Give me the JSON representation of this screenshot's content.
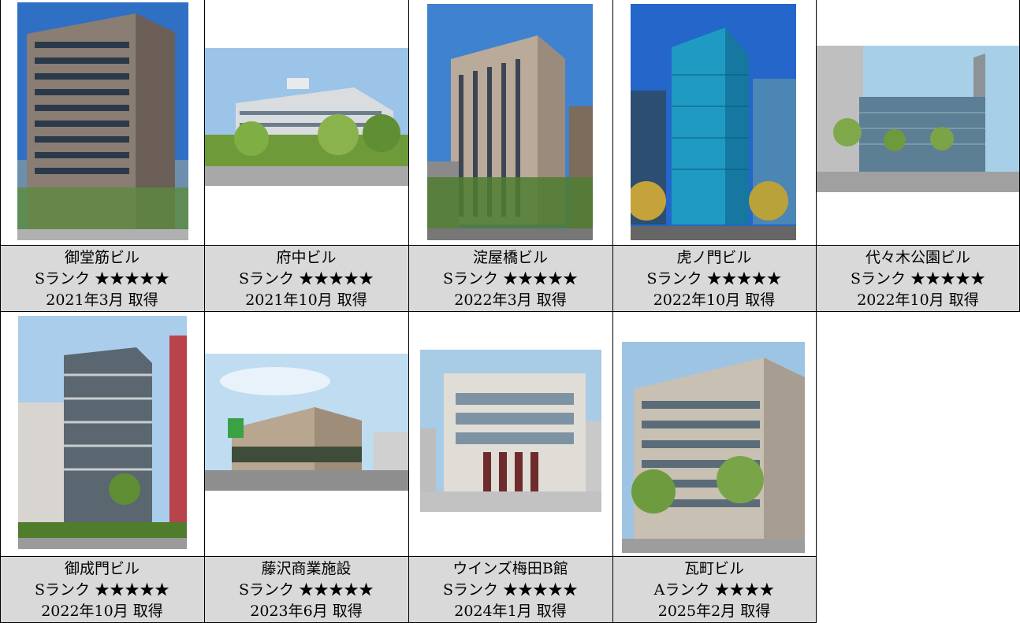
{
  "buildings": [
    {
      "name": "御堂筋ビル",
      "rank": "Sランク",
      "stars": "★★★★★",
      "acquired": "2021年3月 取得"
    },
    {
      "name": "府中ビル",
      "rank": "Sランク",
      "stars": "★★★★★",
      "acquired": "2021年10月 取得"
    },
    {
      "name": "淀屋橋ビル",
      "rank": "Sランク",
      "stars": "★★★★★",
      "acquired": "2022年3月 取得"
    },
    {
      "name": "虎ノ門ビル",
      "rank": "Sランク",
      "stars": "★★★★★",
      "acquired": "2022年10月 取得"
    },
    {
      "name": "代々木公園ビル",
      "rank": "Sランク",
      "stars": "★★★★★",
      "acquired": "2022年10月 取得"
    },
    {
      "name": "御成門ビル",
      "rank": "Sランク",
      "stars": "★★★★★",
      "acquired": "2022年10月 取得"
    },
    {
      "name": "藤沢商業施設",
      "rank": "Sランク",
      "stars": "★★★★★",
      "acquired": "2023年6月 取得"
    },
    {
      "name": "ウインズ梅田B館",
      "rank": "Sランク",
      "stars": "★★★★★",
      "acquired": "2024年1月 取得"
    },
    {
      "name": "瓦町ビル",
      "rank": "Aランク",
      "stars": "★★★★",
      "acquired": "2025年2月 取得"
    }
  ],
  "colors": {
    "caption_bg": "#d9d9d9",
    "border": "#000000"
  }
}
